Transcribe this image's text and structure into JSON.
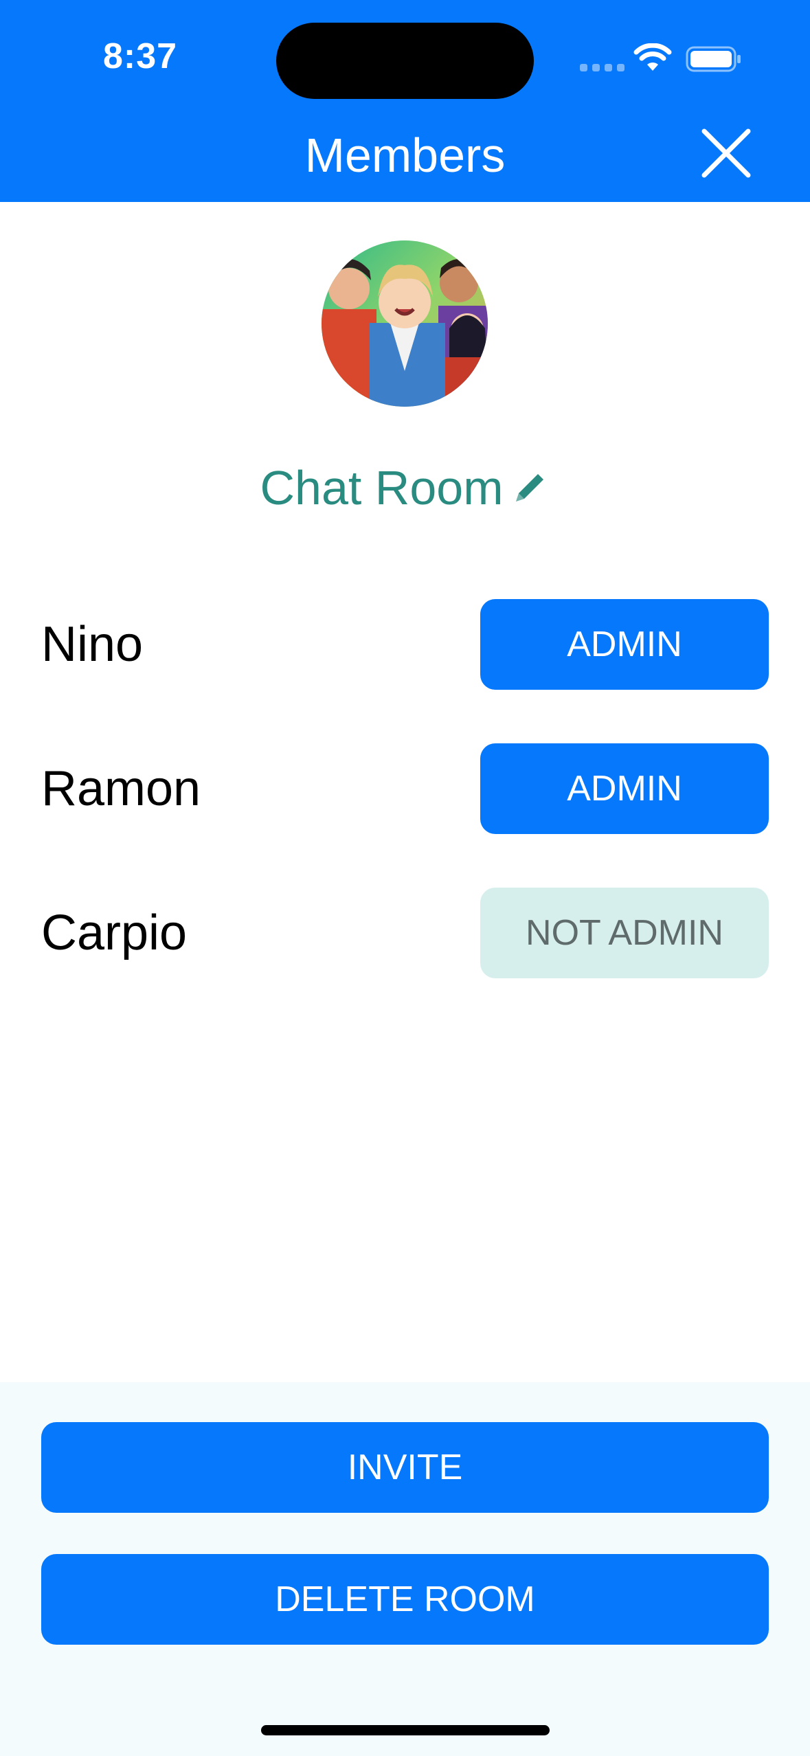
{
  "status_bar": {
    "time": "8:37"
  },
  "header": {
    "title": "Members"
  },
  "room": {
    "name": "Chat Room",
    "avatar_icon": "group-avatar-image"
  },
  "members": [
    {
      "name": "Nino",
      "role_label": "ADMIN",
      "is_admin": true
    },
    {
      "name": "Ramon",
      "role_label": "ADMIN",
      "is_admin": true
    },
    {
      "name": "Carpio",
      "role_label": "NOT ADMIN",
      "is_admin": false
    }
  ],
  "actions": {
    "invite_label": "INVITE",
    "delete_label": "DELETE ROOM"
  },
  "colors": {
    "primary": "#0578fb",
    "accent_teal": "#2a8b80",
    "not_admin_bg": "#d6efed",
    "footer_bg": "#f4fbfc"
  }
}
